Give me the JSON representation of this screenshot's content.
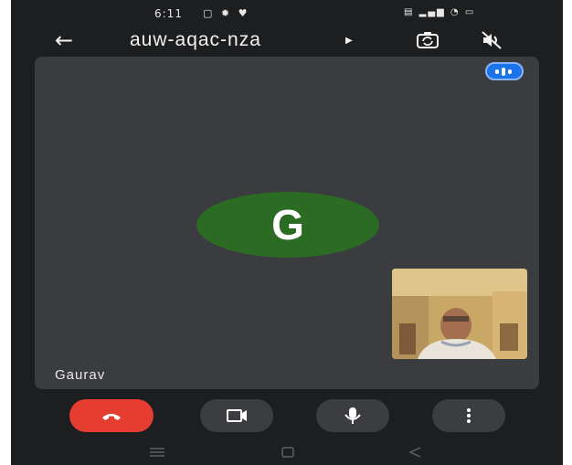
{
  "status_bar": {
    "time": "6:11",
    "icons_left": [
      "notification-icon",
      "settings-icon",
      "heart-icon"
    ],
    "icons_right": [
      "sim-signal-icon",
      "signal-bars-icon",
      "wifi-signal-icon",
      "battery-icon"
    ]
  },
  "top_bar": {
    "meeting_code": "auw-aqac-nza",
    "icons": [
      "back-arrow-icon",
      "meeting-info-arrow-icon",
      "switch-camera-icon",
      "audio-output-off-icon"
    ]
  },
  "main_tile": {
    "avatar_letter": "G",
    "participant_name": "Gaurav",
    "avatar_color": "#2b6b23"
  },
  "controls": {
    "buttons": [
      "end-call-button",
      "camera-button",
      "microphone-button",
      "more-options-button"
    ],
    "end_call_color": "#e53d2f"
  },
  "nav_bar": {
    "items": [
      "recent-apps-icon",
      "home-icon",
      "back-icon"
    ]
  }
}
